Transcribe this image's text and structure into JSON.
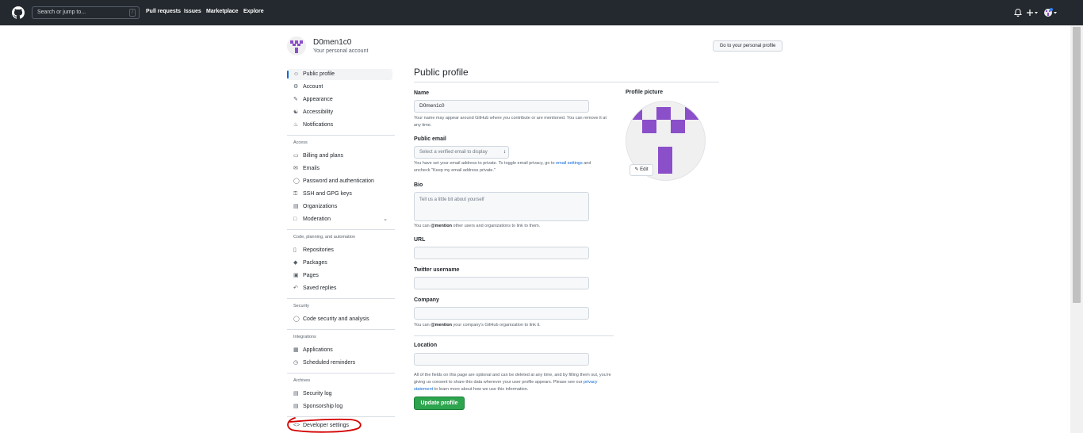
{
  "header": {
    "search_placeholder": "Search or jump to...",
    "search_shortcut": "/",
    "nav": [
      "Pull requests",
      "Issues",
      "Marketplace",
      "Explore"
    ],
    "icons": [
      "github-logo",
      "bell-icon",
      "plus-icon",
      "avatar-dropdown"
    ]
  },
  "account": {
    "username": "D0men1c0",
    "subtitle": "Your personal account",
    "goto_button": "Go to your personal profile"
  },
  "sidebar": {
    "group1": [
      "Public profile",
      "Account",
      "Appearance",
      "Accessibility",
      "Notifications"
    ],
    "access_heading": "Access",
    "access": [
      "Billing and plans",
      "Emails",
      "Password and authentication",
      "SSH and GPG keys",
      "Organizations",
      "Moderation"
    ],
    "code_heading": "Code, planning, and automation",
    "code": [
      "Repositories",
      "Packages",
      "Pages",
      "Saved replies"
    ],
    "security_heading": "Security",
    "security": [
      "Code security and analysis"
    ],
    "integrations_heading": "Integrations",
    "integrations": [
      "Applications",
      "Scheduled reminders"
    ],
    "archives_heading": "Archives",
    "archives": [
      "Security log",
      "Sponsorship log"
    ],
    "developer": "Developer settings"
  },
  "main": {
    "title": "Public profile",
    "name_label": "Name",
    "name_value": "D0men1c0",
    "name_note": "Your name may appear around GitHub where you contribute or are mentioned. You can remove it at any time.",
    "email_label": "Public email",
    "email_select": "Select a verified email to display",
    "email_note_1": "You have set your email address to private. To toggle email privacy, go to",
    "email_note_link": "email settings",
    "email_note_2": "and uncheck \"Keep my email address private.\"",
    "bio_label": "Bio",
    "bio_placeholder": "Tell us a little bit about yourself",
    "bio_note_mention": "@mention",
    "bio_note_before": "You can",
    "bio_note_after": "other users and organizations to link to them.",
    "url_label": "URL",
    "twitter_label": "Twitter username",
    "company_label": "Company",
    "company_note_before": "You can",
    "company_note_mention": "@mention",
    "company_note_after": "your company's GitHub organization to link it.",
    "location_label": "Location",
    "footer_note_1": "All of the fields on this page are optional and can be deleted at any time, and by filling them out, you're giving us consent to share this data wherever your user profile appears. Please see our",
    "footer_note_link": "privacy statement",
    "footer_note_2": "to learn more about how we use this information.",
    "update_button": "Update profile",
    "profile_picture_label": "Profile picture",
    "edit_button": "Edit"
  },
  "colors": {
    "header_bg": "#24292f",
    "accent_blue": "#0969da",
    "button_green": "#2da44e",
    "identicon_purple": "#8a4fc9",
    "annotation_red": "#d40000"
  }
}
